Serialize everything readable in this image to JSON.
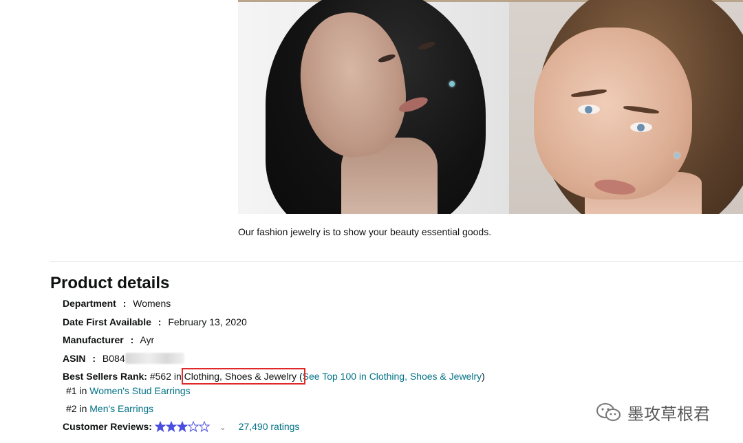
{
  "caption": "Our fashion jewelry is to show your beauty essential goods.",
  "section_title": "Product details",
  "details": {
    "department": {
      "label": "Department",
      "sep": ":",
      "value": "Womens"
    },
    "date_first": {
      "label": "Date First Available",
      "sep": ":",
      "value": "February 13, 2020"
    },
    "manufacturer": {
      "label": "Manufacturer",
      "sep": ":",
      "value": "Ayr"
    },
    "asin": {
      "label": "ASIN",
      "sep": ":",
      "value": "B084"
    },
    "best_sellers": {
      "label": "Best Sellers Rank:",
      "rank_prefix": "#562 in",
      "category": "Clothing, Shoes & Jewelry",
      "paren_open": "(",
      "see_top": "See Top 100 in Clothing, Shoes & Jewelry",
      "paren_close": ")",
      "sub1_prefix": "#1 in",
      "sub1_link": "Women's Stud Earrings",
      "sub2_prefix": "#2 in",
      "sub2_link": "Men's Earrings"
    },
    "reviews": {
      "label": "Customer Reviews:",
      "rating_stars": 3,
      "ratings_count": "27,490 ratings"
    }
  },
  "watermark": "墨攻草根君",
  "colors": {
    "link": "#007185",
    "highlight": "#e0292b",
    "star": "#4a4ee0"
  }
}
